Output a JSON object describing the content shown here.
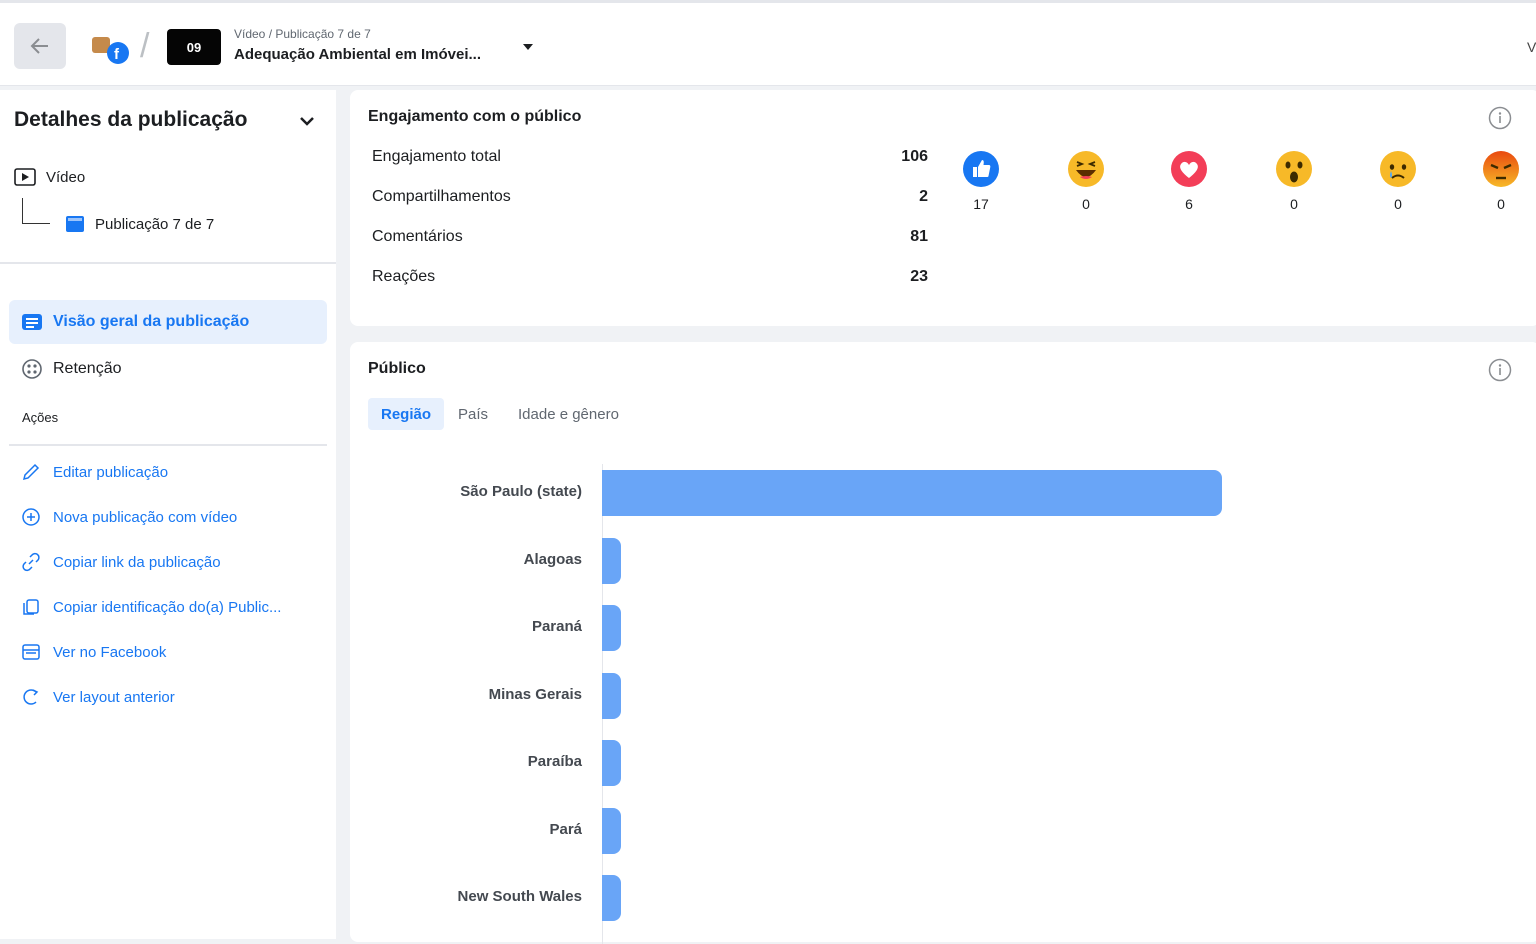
{
  "header": {
    "back_icon": "arrow-left-icon",
    "brand_icon": "facebook-page-icon",
    "thumbnail_label": "09",
    "breadcrumb": "Vídeo / Publicação 7 de 7",
    "post_title": "Adequação Ambiental em Imóvei...",
    "edge_text": "V"
  },
  "sidebar": {
    "title": "Detalhes da publicação",
    "tree": {
      "video_label": "Vídeo",
      "post_label": "Publicação 7 de 7"
    },
    "nav": [
      {
        "label": "Visão geral da publicação",
        "icon": "overview-icon",
        "active": true
      },
      {
        "label": "Retenção",
        "icon": "retention-icon",
        "active": false
      }
    ],
    "actions_label": "Ações",
    "actions": [
      {
        "label": "Editar publicação",
        "icon": "pencil-icon"
      },
      {
        "label": "Nova publicação com vídeo",
        "icon": "plus-circle-icon"
      },
      {
        "label": "Copiar link da publicação",
        "icon": "link-icon"
      },
      {
        "label": "Copiar identificação do(a) Public...",
        "icon": "copy-icon"
      },
      {
        "label": "Ver no Facebook",
        "icon": "browser-icon"
      },
      {
        "label": "Ver layout anterior",
        "icon": "undo-icon"
      }
    ]
  },
  "engagement": {
    "title": "Engajamento com o público",
    "metrics": [
      {
        "label": "Engajamento total",
        "value": "106"
      },
      {
        "label": "Compartilhamentos",
        "value": "2"
      },
      {
        "label": "Comentários",
        "value": "81"
      },
      {
        "label": "Reações",
        "value": "23"
      }
    ],
    "reactions": [
      {
        "name": "like",
        "icon": "like-reaction-icon",
        "count": "17",
        "color": "#1877f2"
      },
      {
        "name": "haha",
        "icon": "haha-reaction-icon",
        "count": "0",
        "color": "#f7b928"
      },
      {
        "name": "love",
        "icon": "love-reaction-icon",
        "count": "6",
        "color": "#f33e58"
      },
      {
        "name": "wow",
        "icon": "wow-reaction-icon",
        "count": "0",
        "color": "#f7b928"
      },
      {
        "name": "sad",
        "icon": "sad-reaction-icon",
        "count": "0",
        "color": "#f7b928"
      },
      {
        "name": "angry",
        "icon": "angry-reaction-icon",
        "count": "0",
        "color": "#e9710f"
      }
    ]
  },
  "audience": {
    "title": "Público",
    "tabs": [
      {
        "label": "Região",
        "active": true
      },
      {
        "label": "País",
        "active": false
      },
      {
        "label": "Idade e gênero",
        "active": false
      }
    ]
  },
  "chart_data": {
    "type": "bar",
    "orientation": "horizontal",
    "categories": [
      "São Paulo (state)",
      "Alagoas",
      "Paraná",
      "Minas Gerais",
      "Paraíba",
      "Pará",
      "New South Wales"
    ],
    "values": [
      100,
      3,
      3,
      3,
      3,
      3,
      3
    ],
    "value_unit": "relative share (%)",
    "bar_color": "#69a5f7",
    "title": "",
    "xlabel": "",
    "ylabel": "",
    "grid": false
  },
  "colors": {
    "accent": "#1877f2",
    "active_bg": "#e7f0fd",
    "page_bg": "#f0f2f5"
  }
}
